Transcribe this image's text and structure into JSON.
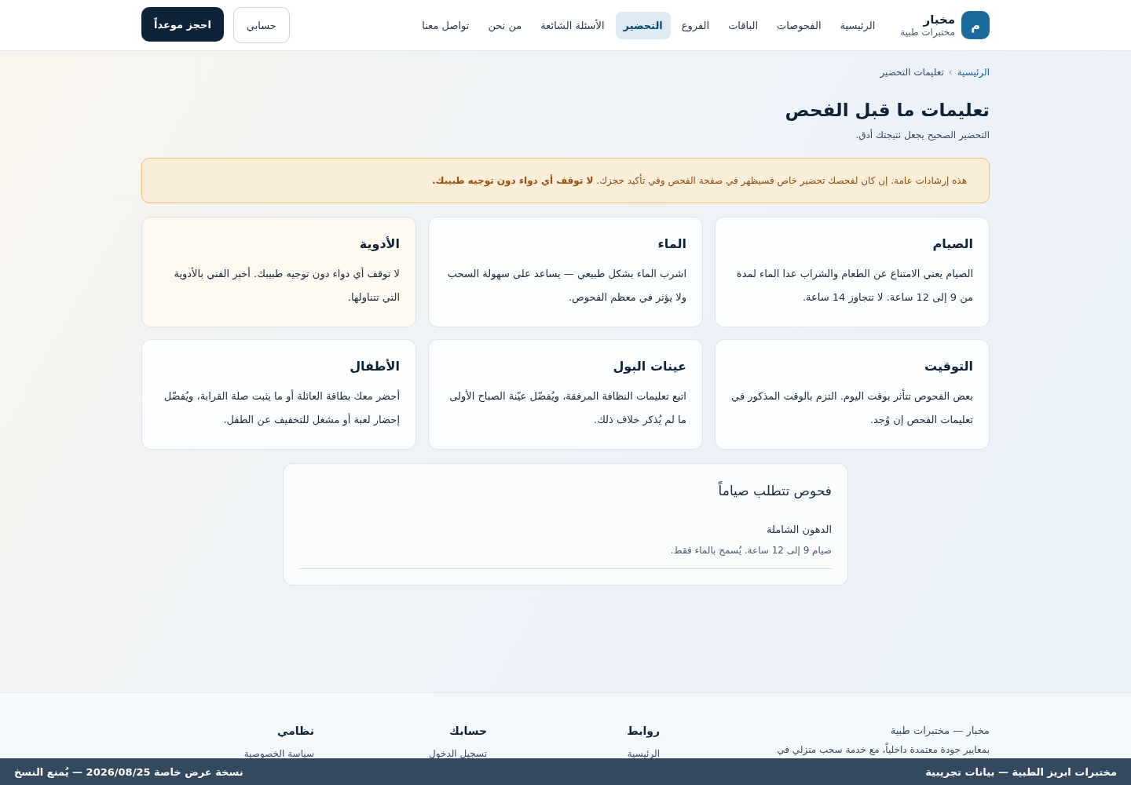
{
  "brand": {
    "mark": "م",
    "name": "مخبار",
    "tagline": "مختبرات طبية"
  },
  "nav": [
    {
      "label": "الرئيسية",
      "selected": false
    },
    {
      "label": "الفحوصات",
      "selected": false
    },
    {
      "label": "الباقات",
      "selected": false
    },
    {
      "label": "الفروع",
      "selected": false
    },
    {
      "label": "التحضير",
      "selected": true
    },
    {
      "label": "الأسئلة الشائعة",
      "selected": false
    },
    {
      "label": "من نحن",
      "selected": false
    },
    {
      "label": "تواصل معنا",
      "selected": false
    }
  ],
  "account_button": "حسابي",
  "book_button": "احجز موعداً",
  "breadcrumb": {
    "home": "الرئيسية",
    "separator": "›",
    "current": "تعليمات التحضير"
  },
  "title": "تعليمات ما قبل الفحص",
  "subtitle": "التحضير الصحيح يجعل نتيجتك أدق.",
  "notice": "هذه إرشادات عامة. إن كان لفحصك تحضير خاص فسيظهر في صفحة الفحص وفي تأكيد حجزك. **لا توقف أي دواء دون توجيه طبيبك.**",
  "cards": [
    {
      "title": "الصيام",
      "text": "الصيام يعني الامتناع عن الطعام والشراب عدا الماء لمدة من 9 إلى 12 ساعة. لا تتجاوز 14 ساعة.",
      "tinted": false
    },
    {
      "title": "الماء",
      "text": "اشرب الماء بشكل طبيعي — يساعد على سهولة السحب ولا يؤثر في معظم الفحوص.",
      "tinted": false
    },
    {
      "title": "الأدوية",
      "text": "لا توقف أي دواء دون توجيه طبيبك. أخبر الفني بالأدوية التي تتناولها.",
      "tinted": true
    },
    {
      "title": "التوقيت",
      "text": "بعض الفحوص تتأثر بوقت اليوم. التزم بالوقت المذكور في تعليمات الفحص إن وُجد.",
      "tinted": false
    },
    {
      "title": "عينات البول",
      "text": "اتبع تعليمات النظافة المرفقة، ويُفضّل عيّنة الصباح الأولى ما لم يُذكر خلاف ذلك.",
      "tinted": false
    },
    {
      "title": "الأطفال",
      "text": "أحضر معك بطاقة العائلة أو ما يثبت صلة القرابة، ويُفضّل إحضار لعبة أو مشغل للتخفيف عن الطفل.",
      "tinted": false
    }
  ],
  "fasting_tests": {
    "title": "فحوص تتطلب صياماً",
    "items": [
      {
        "name": "الدهون الشاملة",
        "note": "صيام 9 إلى 12 ساعة. يُسمح بالماء فقط."
      }
    ]
  },
  "footer": {
    "columns": [
      {
        "heading": "مخبار — مختبرات طبية",
        "text": "بمعايير جودة معتمدة داخلياً، مع خدمة سحب منزلي في"
      },
      {
        "heading": "روابط",
        "text": "الرئيسية"
      },
      {
        "heading": "حسابك",
        "text": "تسجيل الدخول"
      },
      {
        "heading": "نظامي",
        "text": "سياسة الخصوصية"
      }
    ]
  },
  "bottom_bar": {
    "title": "مختبرات ابريز الطبية — بيانات تجريبية",
    "note": "نسخة عرض خاصة 2026/08/25 — يُمنع النسخ"
  }
}
